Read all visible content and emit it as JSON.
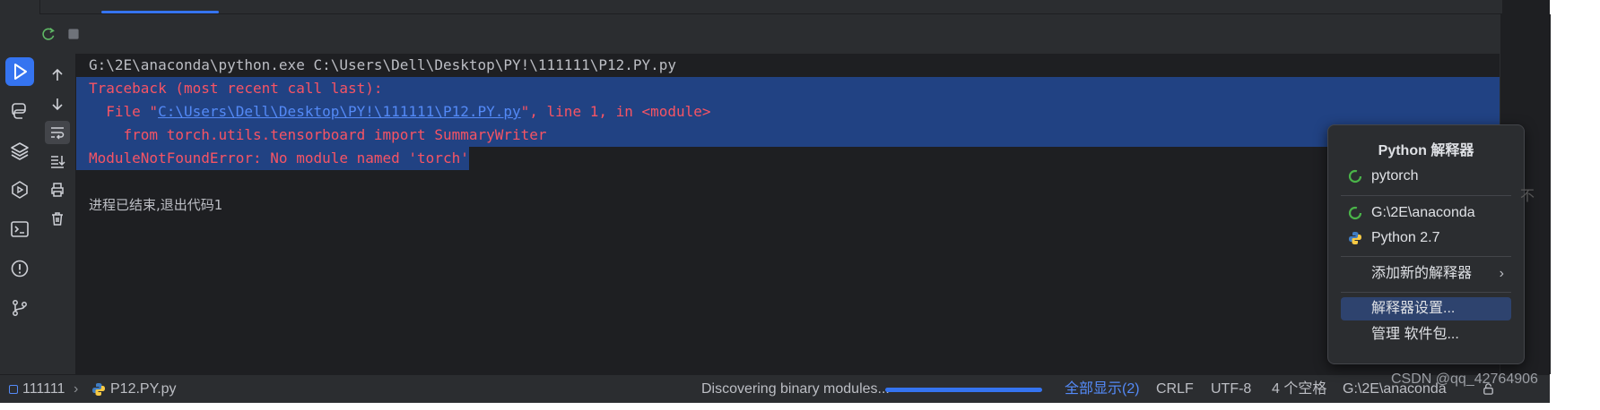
{
  "console": {
    "command_line": "G:\\2E\\anaconda\\python.exe C:\\Users\\Dell\\Desktop\\PY!\\111111\\P12.PY.py",
    "traceback_header": "Traceback (most recent call last):",
    "file_prefix": "  File \"",
    "file_link": "C:\\Users\\Dell\\Desktop\\PY!\\111111\\P12.PY.py",
    "file_suffix": "\", line 1, in <module>",
    "source_line": "    from torch.utils.tensorboard import SummaryWriter",
    "error_line": "ModuleNotFoundError: No module named 'torch'",
    "exit_message": "进程已结束,退出代码1"
  },
  "statusbar": {
    "project": "111111",
    "file": "P12.PY.py",
    "task_text": "Discovering binary modules...",
    "task_progress": 1.0,
    "show_all": "全部显示(2)",
    "line_ending": "CRLF",
    "encoding": "UTF-8",
    "indent": "4 个空格",
    "interpreter": "G:\\2E\\anaconda"
  },
  "popup": {
    "title": "Python 解释器",
    "items": [
      {
        "label": "pytorch",
        "icon": "conda-env-icon"
      },
      {
        "label": "G:\\2E\\anaconda",
        "icon": "conda-env-icon"
      },
      {
        "label": "Python 2.7",
        "icon": "python-logo-icon"
      },
      {
        "label": "添加新的解释器",
        "icon": "",
        "submenu": true
      },
      {
        "label": "解释器设置...",
        "icon": "",
        "highlighted": true
      },
      {
        "label": "管理 软件包...",
        "icon": ""
      }
    ]
  },
  "watermark": "CSDN @qq_42764906",
  "stray_text": "不",
  "colors": {
    "accent": "#3574f0",
    "error_text": "#f75464",
    "link": "#548af7",
    "selection": "#214283"
  }
}
